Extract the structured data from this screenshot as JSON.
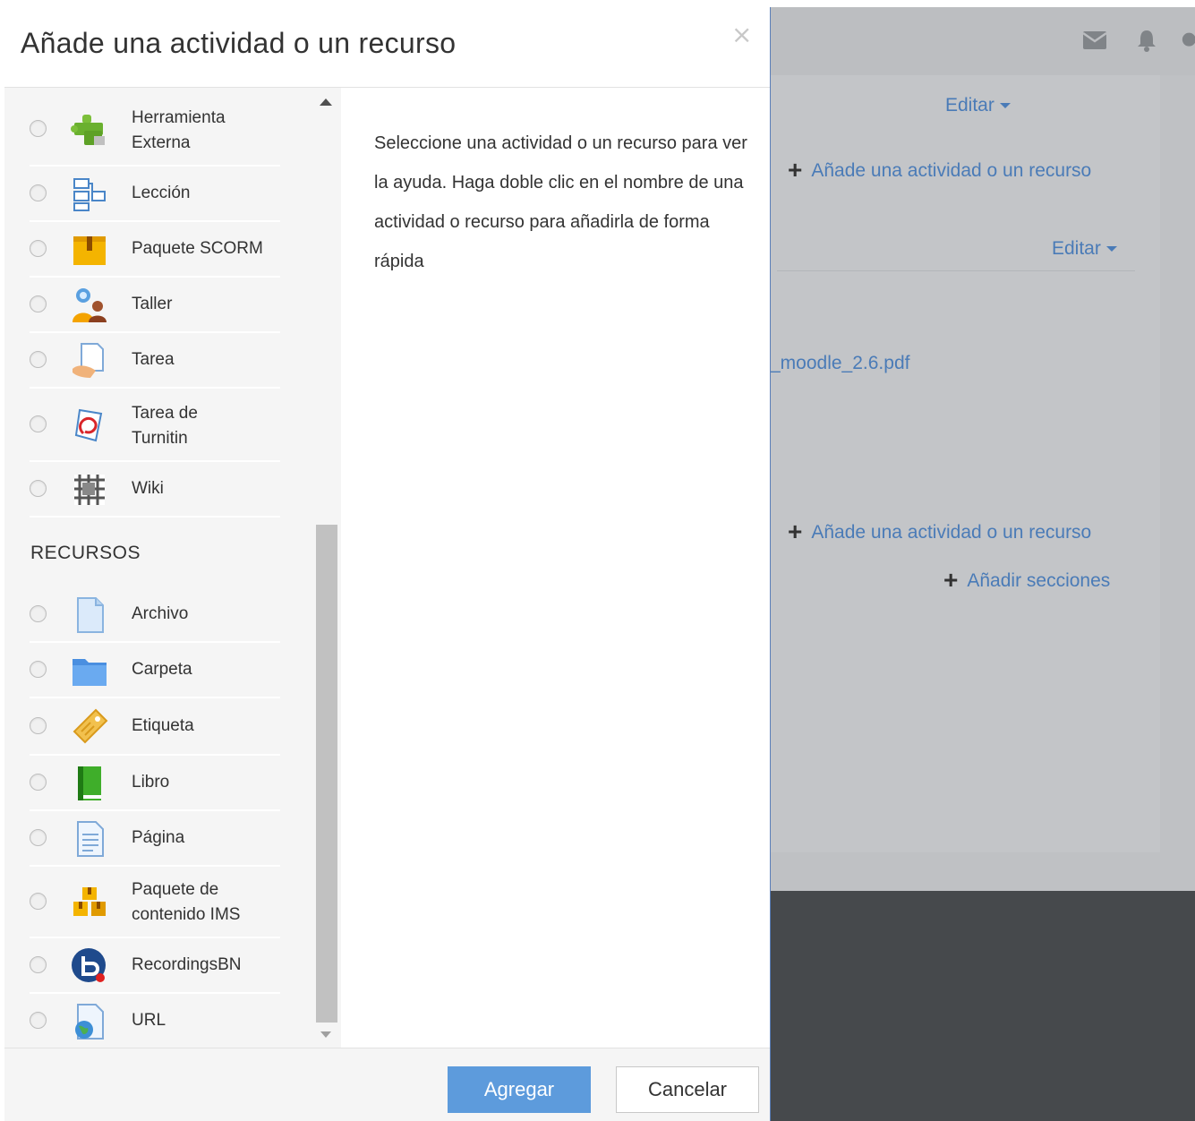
{
  "modal": {
    "title": "Añade una actividad o un recurso",
    "close_symbol": "×",
    "help_text": "Seleccione una actividad o un recurso para ver la ayuda. Haga doble clic en el nombre de una actividad o recurso para añadirla de forma rápida",
    "activities": [
      {
        "label": "Herramienta Externa",
        "icon": "puzzle-icon"
      },
      {
        "label": "Lección",
        "icon": "lesson-icon"
      },
      {
        "label": "Paquete SCORM",
        "icon": "scorm-package-icon"
      },
      {
        "label": "Taller",
        "icon": "workshop-icon"
      },
      {
        "label": "Tarea",
        "icon": "assignment-icon"
      },
      {
        "label": "Tarea de Turnitin",
        "icon": "turnitin-icon"
      },
      {
        "label": "Wiki",
        "icon": "wiki-icon"
      }
    ],
    "resources_heading": "RECURSOS",
    "resources": [
      {
        "label": "Archivo",
        "icon": "file-icon"
      },
      {
        "label": "Carpeta",
        "icon": "folder-icon"
      },
      {
        "label": "Etiqueta",
        "icon": "label-tag-icon"
      },
      {
        "label": "Libro",
        "icon": "book-icon"
      },
      {
        "label": "Página",
        "icon": "page-icon"
      },
      {
        "label": "Paquete de contenido IMS",
        "icon": "ims-package-icon"
      },
      {
        "label": "RecordingsBN",
        "icon": "bigbluebutton-icon"
      },
      {
        "label": "URL",
        "icon": "url-globe-icon"
      }
    ],
    "add_button": "Agregar",
    "cancel_button": "Cancelar"
  },
  "background": {
    "edit_label_1": "Editar",
    "add_activity_1": "Añade una actividad o un recurso",
    "edit_label_2": "Editar",
    "file_link": "_moodle_2.6.pdf",
    "add_activity_2": "Añade una actividad o un recurso",
    "add_sections": "Añadir secciones"
  },
  "colors": {
    "accent": "#5d9bdc",
    "link": "#4a7bb7",
    "dark_footer": "#46494c"
  }
}
